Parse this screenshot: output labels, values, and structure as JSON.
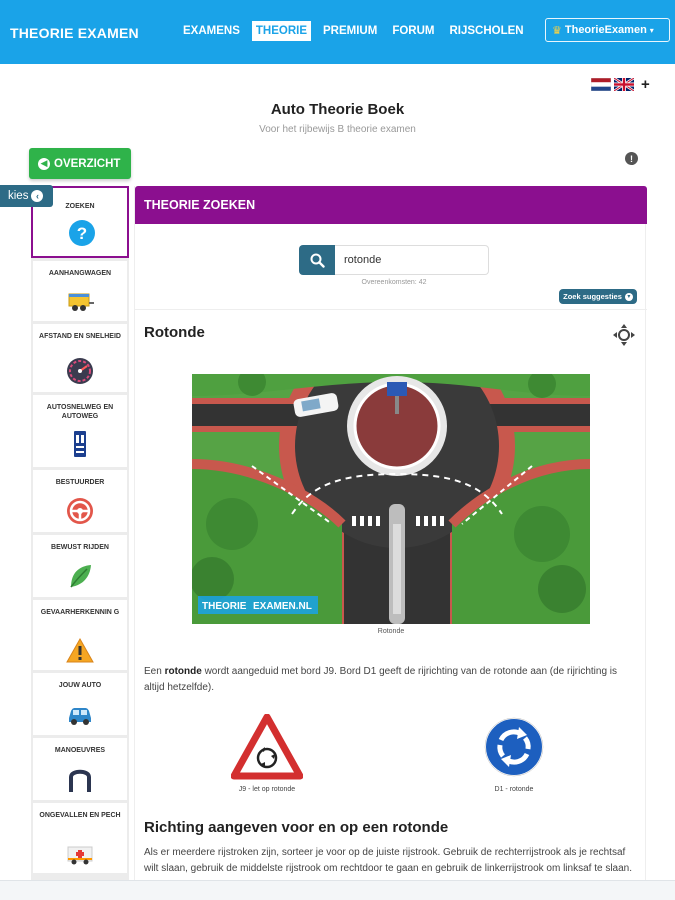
{
  "nav": {
    "brand": "THEORIE EXAMEN",
    "links": [
      "EXAMENS",
      "THEORIE",
      "PREMIUM",
      "FORUM",
      "RIJSCHOLEN"
    ],
    "active_index": 1,
    "user_menu": "TheorieExamen"
  },
  "languages": {
    "flags": [
      "nl-flag",
      "uk-flag"
    ],
    "add": "+"
  },
  "page": {
    "title": "Auto Theorie Boek",
    "subtitle": "Voor het rijbewijs B theorie examen"
  },
  "overzicht_label": "OVERZICHT",
  "kies_label": "kies",
  "sidebar": {
    "items": [
      {
        "label": "ZOEKEN",
        "icon": "question-icon",
        "selected": true
      },
      {
        "label": "AANHANGWAGEN",
        "icon": "trailer-icon"
      },
      {
        "label": "AFSTAND EN SNELHEID",
        "icon": "speedometer-icon"
      },
      {
        "label": "AUTOSNELWEG EN AUTOWEG",
        "icon": "motorway-sign-icon"
      },
      {
        "label": "BESTUURDER",
        "icon": "steering-wheel-icon"
      },
      {
        "label": "BEWUST RIJDEN",
        "icon": "leaf-icon"
      },
      {
        "label": "GEVAARHERKENNIN G",
        "icon": "warning-icon"
      },
      {
        "label": "JOUW AUTO",
        "icon": "car-icon"
      },
      {
        "label": "MANOEUVRES",
        "icon": "u-turn-icon"
      },
      {
        "label": "ONGEVALLEN EN PECH",
        "icon": "ambulance-icon"
      }
    ]
  },
  "panel": {
    "header": "THEORIE ZOEKEN",
    "search": {
      "value": "rotonde",
      "placeholder": "",
      "count": "Overeenkomsten: 42",
      "suggest_label": "Zoek suggesties"
    },
    "section_title": "Rotonde",
    "image_watermark_a": "THEORIE",
    "image_watermark_b": "EXAMEN.NL",
    "image_caption": "Rotonde",
    "paragraph_prefix": "Een ",
    "paragraph_bold": "rotonde",
    "paragraph_rest": " wordt aangeduid met bord J9. Bord D1 geeft de rijrichting van de rotonde aan (de rijrichting is altijd hetzelfde).",
    "signs": [
      {
        "caption": "J9 - let op rotonde",
        "icon": "roundabout-warning-sign-icon"
      },
      {
        "caption": "D1 - rotonde",
        "icon": "roundabout-mandatory-sign-icon"
      }
    ],
    "section_title2": "Richting aangeven voor en op een rotonde",
    "paragraph2": "Als er meerdere rijstroken zijn, sorteer je voor op de juiste rijstrook. Gebruik de rechterrijstrook als je rechtsaf wilt slaan, gebruik de middelste rijstrook om rechtdoor te gaan en gebruik de linkerrijstrook om linksaf te slaan."
  },
  "colors": {
    "nav": "#1aa3e8",
    "purple": "#8b0f8f",
    "green": "#2fb34a",
    "teal": "#2d6b86"
  }
}
